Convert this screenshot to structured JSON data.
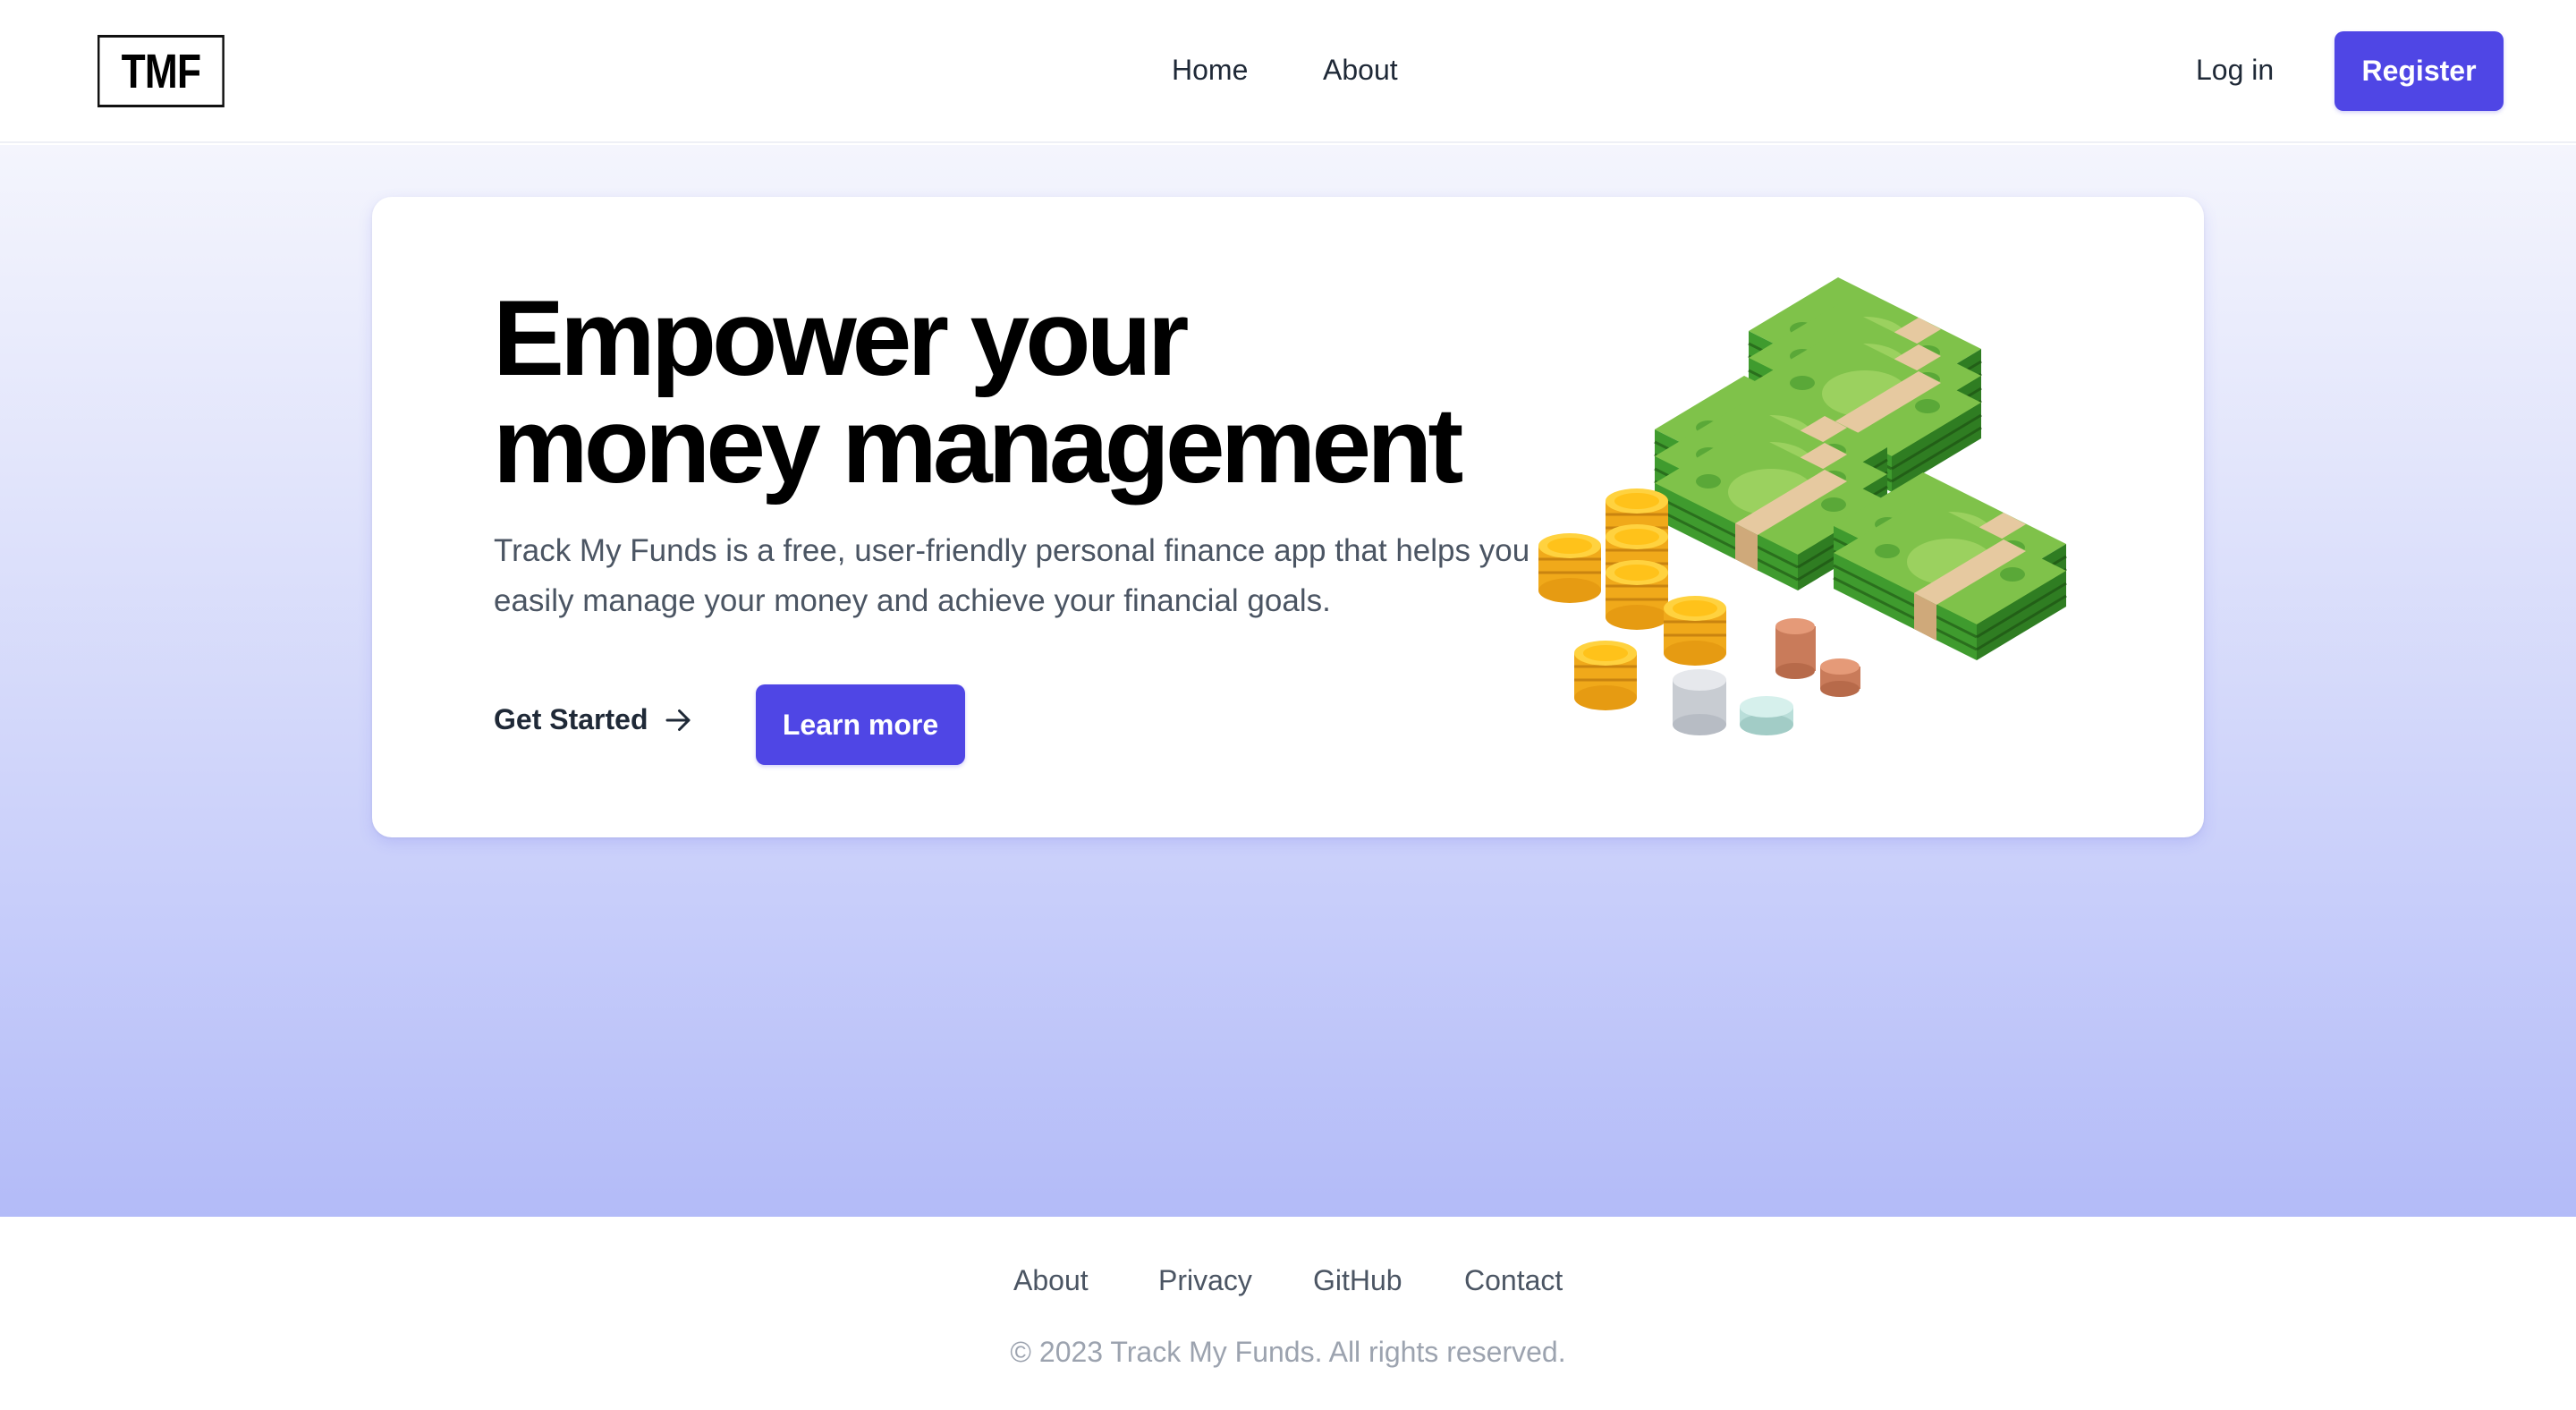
{
  "header": {
    "logo_text": "TMF",
    "nav": [
      {
        "label": "Home"
      },
      {
        "label": "About"
      }
    ],
    "login_label": "Log in",
    "register_label": "Register"
  },
  "hero": {
    "headline_line1": "Empower your",
    "headline_line2": "money management",
    "description": "Track My Funds is a free, user-friendly personal finance app that helps you easily manage your money and achieve your financial goals.",
    "get_started_label": "Get Started",
    "learn_more_label": "Learn more",
    "illustration": "money-stacks-and-coins-illustration"
  },
  "footer": {
    "links": [
      {
        "label": "About"
      },
      {
        "label": "Privacy"
      },
      {
        "label": "GitHub"
      },
      {
        "label": "Contact"
      }
    ],
    "copyright": "© 2023 Track My Funds. All rights reserved."
  },
  "colors": {
    "accent": "#4f46e5",
    "money_green": "#3f9b2e",
    "coin_gold": "#f5b81c"
  }
}
